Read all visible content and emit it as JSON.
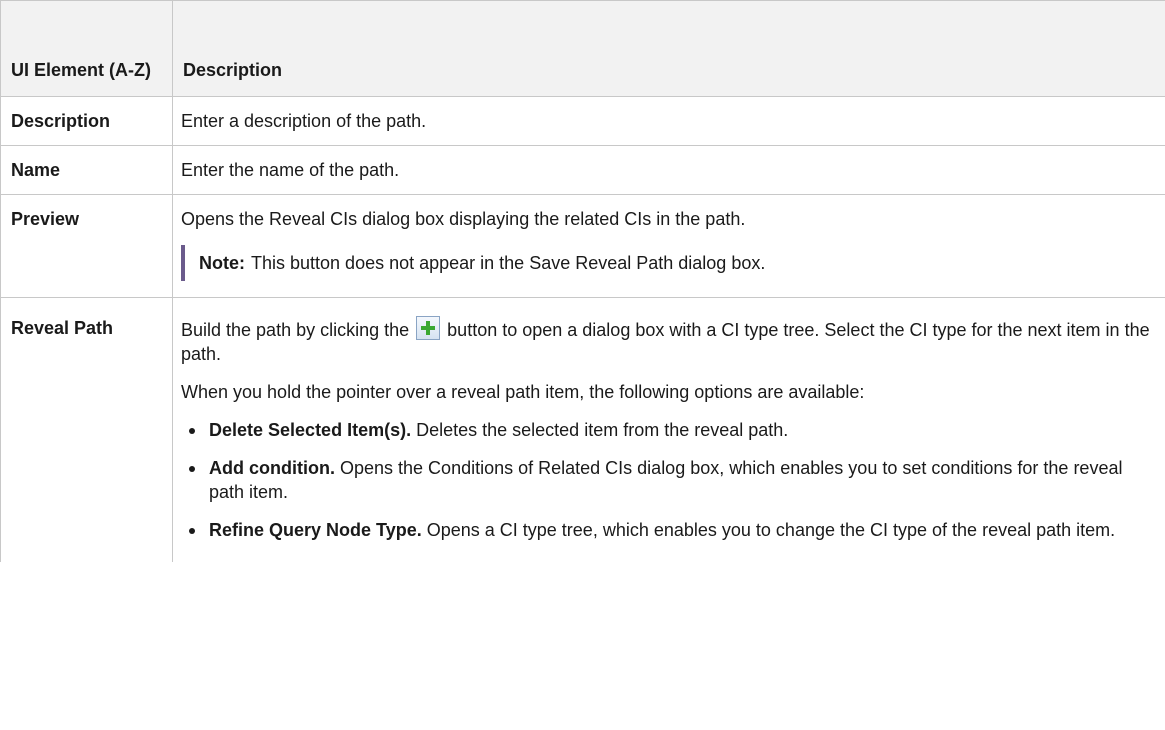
{
  "header": {
    "col1": "UI Element (A-Z)",
    "col2": "Description"
  },
  "rows": {
    "description": {
      "element": "Description",
      "text": "Enter a description of the path."
    },
    "name": {
      "element": "Name",
      "text": "Enter the name of the path."
    },
    "preview": {
      "element": "Preview",
      "text": "Opens the Reveal CIs dialog box displaying the related CIs in the path.",
      "note_label": "Note:",
      "note_text": "This button does not appear in the Save Reveal Path dialog box."
    },
    "reveal_path": {
      "element": "Reveal Path",
      "text_before_icon": "Build the path by clicking the",
      "icon": "add-plus-icon",
      "text_after_icon": "button to open a dialog box with a CI type tree. Select the CI type for the next item in the path.",
      "hover_text": "When you hold the pointer over a reveal path item, the following options are available:",
      "options": [
        {
          "title": "Delete Selected Item(s).",
          "text": "Deletes the selected item from the reveal path."
        },
        {
          "title": "Add condition.",
          "text": "Opens the Conditions of Related CIs dialog box, which enables you to set conditions for the reveal path item."
        },
        {
          "title": "Refine Query Node Type.",
          "text": "Opens a CI type tree, which enables you to change the CI type of the reveal path item."
        }
      ]
    }
  },
  "colors": {
    "header_bg": "#f2f2f2",
    "border": "#c8c8c8",
    "note_bar": "#6b5b8c",
    "plus_green": "#3aa832"
  }
}
